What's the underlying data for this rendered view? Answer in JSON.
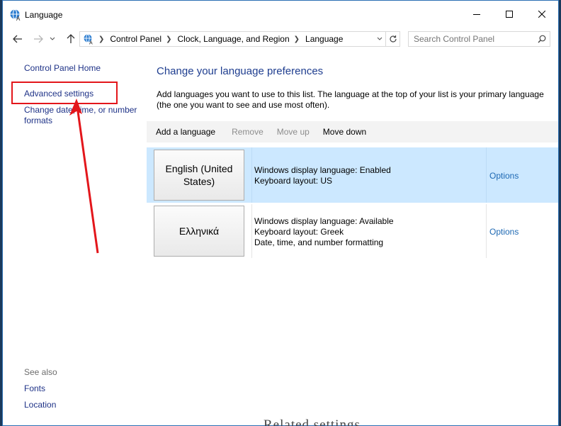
{
  "window": {
    "title": "Language"
  },
  "address": {
    "crumbs": [
      "Control Panel",
      "Clock, Language, and Region",
      "Language"
    ],
    "search_placeholder": "Search Control Panel"
  },
  "left_nav": {
    "home": "Control Panel Home",
    "advanced": "Advanced settings",
    "date_formats": "Change date, time, or number formats",
    "see_also": "See also",
    "fonts": "Fonts",
    "location": "Location"
  },
  "main": {
    "heading": "Change your language preferences",
    "description": "Add languages you want to use to this list. The language at the top of your list is your primary language (the one you want to see and use most often).",
    "toolbar": {
      "add": "Add a language",
      "remove": "Remove",
      "move_up": "Move up",
      "move_down": "Move down"
    },
    "languages": [
      {
        "name": "English (United States)",
        "line1": "Windows display language: Enabled",
        "line2": "Keyboard layout: US",
        "line3": "",
        "options": "Options"
      },
      {
        "name": "Ελληνικά",
        "line1": "Windows display language: Available",
        "line2": "Keyboard layout: Greek",
        "line3": "Date, time, and number formatting",
        "options": "Options"
      }
    ]
  },
  "background": {
    "partial_text": "Related settings"
  },
  "colors": {
    "link": "#1e3287",
    "heading": "#1e3d8f",
    "selected_row": "#cce8ff",
    "annotation": "#e3161b",
    "options_link": "#1e69b3"
  }
}
